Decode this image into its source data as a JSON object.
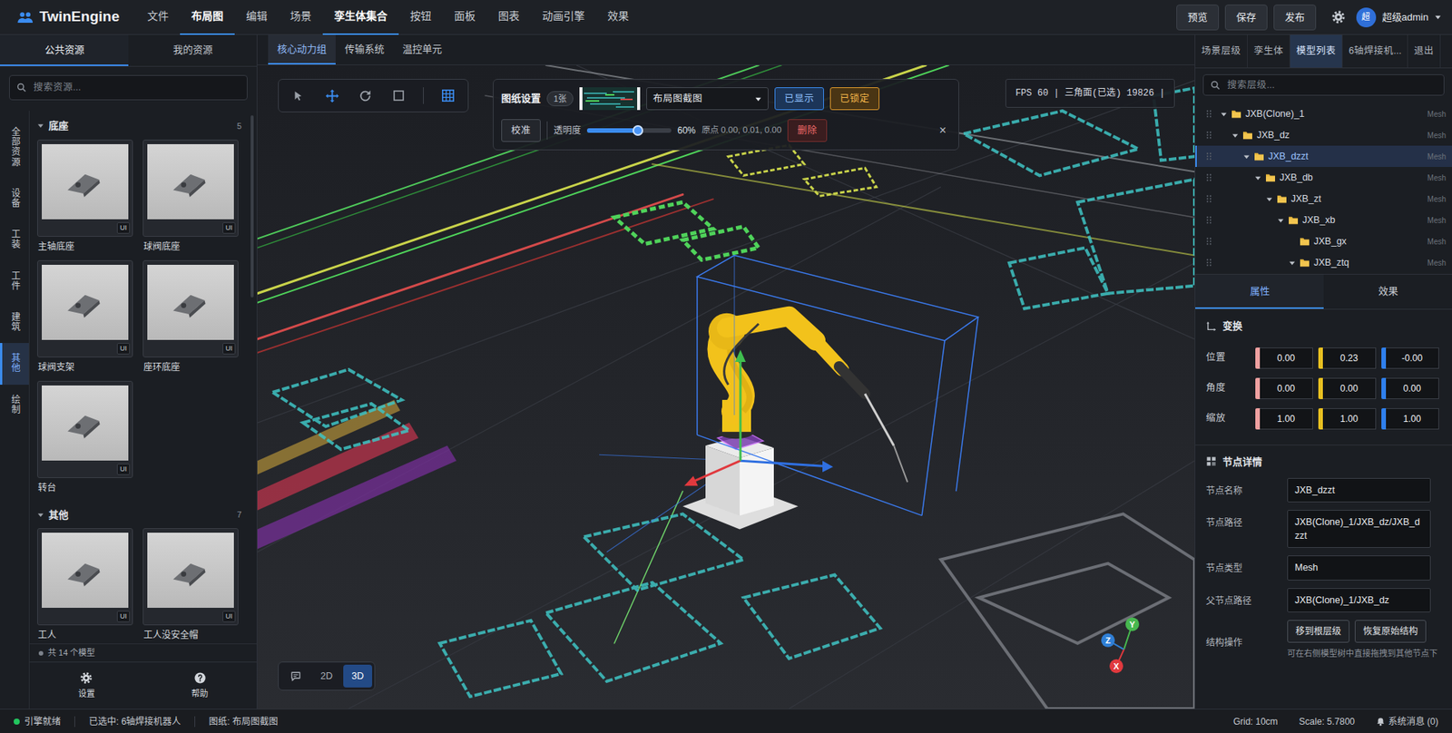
{
  "app": {
    "title": "TwinEngine"
  },
  "menu": [
    {
      "label": "文件",
      "selected": false
    },
    {
      "label": "布局图",
      "selected": true
    },
    {
      "label": "编辑",
      "selected": false
    },
    {
      "label": "场景",
      "selected": false
    },
    {
      "label": "孪生体集合",
      "selected": true
    },
    {
      "label": "按钮",
      "selected": false
    },
    {
      "label": "面板",
      "selected": false
    },
    {
      "label": "图表",
      "selected": false
    },
    {
      "label": "动画引擎",
      "selected": false
    },
    {
      "label": "效果",
      "selected": false
    }
  ],
  "actions": [
    {
      "label": "预览"
    },
    {
      "label": "保存"
    },
    {
      "label": "发布"
    }
  ],
  "user": {
    "avatar": "超",
    "name": "超级admin"
  },
  "left": {
    "tabs": [
      {
        "label": "公共资源",
        "selected": true
      },
      {
        "label": "我的资源",
        "selected": false
      }
    ],
    "search": {
      "placeholder": "搜索资源..."
    },
    "categories": [
      {
        "label": "全部资源",
        "selected": false
      },
      {
        "label": "设备",
        "selected": false
      },
      {
        "label": "工装",
        "selected": false
      },
      {
        "label": "工件",
        "selected": false
      },
      {
        "label": "建筑",
        "selected": false
      },
      {
        "label": "其他",
        "selected": true
      },
      {
        "label": "绘制",
        "selected": false
      }
    ],
    "sections": [
      {
        "title": "底座",
        "count": "5",
        "expanded": true,
        "items": [
          {
            "label": "主轴底座",
            "badge": "UI"
          },
          {
            "label": "球阀底座",
            "badge": "UI"
          },
          {
            "label": "球阀支架",
            "badge": "UI"
          },
          {
            "label": "座环底座",
            "badge": "UI"
          },
          {
            "label": "转台",
            "badge": "UI"
          }
        ]
      },
      {
        "title": "其他",
        "count": "7",
        "expanded": true,
        "items": [
          {
            "label": "工人",
            "badge": "UI"
          },
          {
            "label": "工人没安全帽",
            "badge": "UI"
          }
        ]
      }
    ],
    "footer": {
      "text": "共 14 个模型"
    },
    "bottom": [
      {
        "kind": "settings",
        "label": "设置"
      },
      {
        "kind": "help",
        "label": "帮助"
      }
    ]
  },
  "scene_tabs": [
    {
      "label": "核心动力组",
      "selected": true
    },
    {
      "label": "传输系统",
      "selected": false
    },
    {
      "label": "温控单元",
      "selected": false
    }
  ],
  "toolbar": [
    {
      "kind": "select",
      "selected": false
    },
    {
      "kind": "move",
      "selected": true
    },
    {
      "kind": "rotate",
      "selected": false
    },
    {
      "kind": "scale",
      "selected": false
    },
    {
      "kind": "grid",
      "selected": true
    }
  ],
  "drawing": {
    "title": "图纸设置",
    "count": "1张",
    "select": "布局图截图",
    "shown": {
      "label": "已显示",
      "on": true
    },
    "locked": {
      "label": "已锁定",
      "on": true
    },
    "calibrate": "校准",
    "opacity": {
      "label": "透明度",
      "level": 0.6,
      "reading": "60%"
    },
    "origin": "原点 0.00, 0.01, 0.00",
    "delete": "删除",
    "close": "×"
  },
  "stats": {
    "text": "FPS 60 | 三角面(已选) 19826 |"
  },
  "view_modes": [
    {
      "kind": "icon",
      "selected": false
    },
    {
      "kind": "text",
      "label": "2D",
      "selected": false
    },
    {
      "kind": "text",
      "label": "3D",
      "selected": true
    }
  ],
  "axes": [
    {
      "label": "Y",
      "color": "#47b84f"
    },
    {
      "label": "Z",
      "color": "#2f7fd6"
    },
    {
      "label": "X",
      "color": "#e0393e"
    }
  ],
  "right": {
    "tabs": [
      {
        "label": "场景层级",
        "selected": false
      },
      {
        "label": "孪生体",
        "selected": false
      },
      {
        "label": "模型列表",
        "selected": true
      },
      {
        "label": "6轴焊接机...",
        "selected": false
      },
      {
        "label": "退出",
        "selected": false
      }
    ],
    "search": {
      "placeholder": "搜索层级..."
    },
    "tree": [
      {
        "label": "JXB(Clone)_1",
        "type": "Mesh",
        "depth": 0,
        "has_children": true,
        "expanded": true,
        "selected": false
      },
      {
        "label": "JXB_dz",
        "type": "Mesh",
        "depth": 1,
        "has_children": true,
        "expanded": true,
        "selected": false
      },
      {
        "label": "JXB_dzzt",
        "type": "Mesh",
        "depth": 2,
        "has_children": true,
        "expanded": true,
        "selected": true
      },
      {
        "label": "JXB_db",
        "type": "Mesh",
        "depth": 3,
        "has_children": true,
        "expanded": true,
        "selected": false
      },
      {
        "label": "JXB_zt",
        "type": "Mesh",
        "depth": 4,
        "has_children": true,
        "expanded": true,
        "selected": false
      },
      {
        "label": "JXB_xb",
        "type": "Mesh",
        "depth": 5,
        "has_children": true,
        "expanded": true,
        "selected": false
      },
      {
        "label": "JXB_gx",
        "type": "Mesh",
        "depth": 6,
        "has_children": false,
        "expanded": false,
        "selected": false
      },
      {
        "label": "JXB_ztq",
        "type": "Mesh",
        "depth": 6,
        "has_children": true,
        "expanded": true,
        "selected": false
      }
    ],
    "prop_tabs": [
      {
        "label": "属性",
        "selected": true
      },
      {
        "label": "效果",
        "selected": false
      }
    ],
    "transform": {
      "title": "变换",
      "rows": [
        {
          "label": "位置",
          "values": [
            {
              "value": "0.00",
              "color": "#f0a0a0"
            },
            {
              "value": "0.23",
              "color": "#e8c020"
            },
            {
              "value": "-0.00",
              "color": "#2f80ed"
            }
          ]
        },
        {
          "label": "角度",
          "values": [
            {
              "value": "0.00",
              "color": "#f0a0a0"
            },
            {
              "value": "0.00",
              "color": "#e8c020"
            },
            {
              "value": "0.00",
              "color": "#2f80ed"
            }
          ]
        },
        {
          "label": "缩放",
          "values": [
            {
              "value": "1.00",
              "color": "#f0a0a0"
            },
            {
              "value": "1.00",
              "color": "#e8c020"
            },
            {
              "value": "1.00",
              "color": "#2f80ed"
            }
          ]
        }
      ]
    },
    "details": {
      "title": "节点详情",
      "fields": [
        {
          "label": "节点名称",
          "value": "JXB_dzzt"
        },
        {
          "label": "节点路径",
          "value": "JXB(Clone)_1/JXB_dz/JXB_dzzt"
        },
        {
          "label": "节点类型",
          "value": "Mesh"
        },
        {
          "label": "父节点路径",
          "value": "JXB(Clone)_1/JXB_dz"
        }
      ],
      "ops": {
        "label": "结构操作",
        "buttons": [
          "移到根层级",
          "恢复原始结构"
        ],
        "hint": "可在右侧模型树中直接拖拽到其他节点下"
      }
    }
  },
  "status": {
    "engine": {
      "label": "引擎就绪",
      "color": "#22c55e"
    },
    "selection": "已选中: 6轴焊接机器人",
    "drawing": "图纸: 布局图截图",
    "grid": "Grid: 10cm",
    "scale": "Scale: 5.7800",
    "messages": "系统消息 (0)"
  }
}
